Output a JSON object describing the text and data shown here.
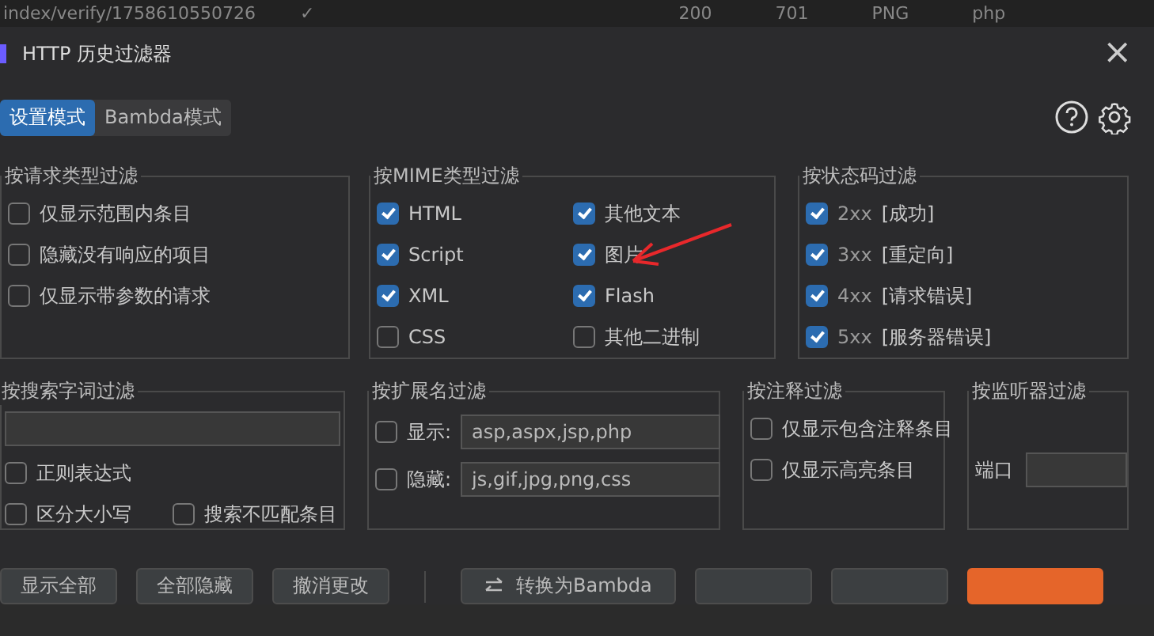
{
  "background_row": [
    "index/verify/1758610550726",
    "✓",
    "200",
    "701",
    "PNG",
    "php"
  ],
  "window": {
    "title": "HTTP 历史过滤器",
    "close": "×"
  },
  "mode_tabs": [
    {
      "label": "设置模式",
      "selected": true
    },
    {
      "label": "Bambda模式",
      "selected": false
    }
  ],
  "request_type": {
    "title": "按请求类型过滤",
    "items": [
      {
        "label": "仅显示范围内条目",
        "checked": false
      },
      {
        "label": "隐藏没有响应的项目",
        "checked": false
      },
      {
        "label": "仅显示带参数的请求",
        "checked": false
      }
    ]
  },
  "mime": {
    "title": "按MIME类型过滤",
    "items": [
      {
        "label": "HTML",
        "checked": true
      },
      {
        "label": "其他文本",
        "checked": true
      },
      {
        "label": "Script",
        "checked": true
      },
      {
        "label": "图片",
        "checked": true
      },
      {
        "label": "XML",
        "checked": true
      },
      {
        "label": "Flash",
        "checked": true
      },
      {
        "label": "CSS",
        "checked": false
      },
      {
        "label": "其他二进制",
        "checked": false
      }
    ]
  },
  "status": {
    "title": "按状态码过滤",
    "items": [
      {
        "code": "2xx",
        "label": "[成功]",
        "checked": true
      },
      {
        "code": "3xx",
        "label": "[重定向]",
        "checked": true
      },
      {
        "code": "4xx",
        "label": "[请求错误]",
        "checked": true
      },
      {
        "code": "5xx",
        "label": "[服务器错误]",
        "checked": true
      }
    ]
  },
  "search": {
    "title": "按搜索字词过滤",
    "regex": {
      "label": "正则表达式",
      "checked": false
    },
    "case": {
      "label": "区分大小写",
      "checked": false
    },
    "negate": {
      "label": "搜索不匹配条目",
      "checked": false
    }
  },
  "extension": {
    "title": "按扩展名过滤",
    "rows": [
      {
        "label": "显示:",
        "checked": false,
        "value": "asp,aspx,jsp,php"
      },
      {
        "label": "隐藏:",
        "checked": false,
        "value": "js,gif,jpg,png,css"
      }
    ]
  },
  "annotation": {
    "title": "按注释过滤",
    "items": [
      {
        "label": "仅显示包含注释条目",
        "checked": false
      },
      {
        "label": "仅显示高亮条目",
        "checked": false
      }
    ]
  },
  "listener": {
    "title": "按监听器过滤",
    "port_label": "端口"
  },
  "buttons": [
    {
      "label": "显示全部",
      "kind": "plain"
    },
    {
      "label": "全部隐藏",
      "kind": "plain"
    },
    {
      "label": "撤消更改",
      "kind": "plain"
    },
    {
      "kind": "separator"
    },
    {
      "label": "转换为Bambda",
      "kind": "convert"
    },
    {
      "kind": "covered"
    },
    {
      "kind": "covered"
    },
    {
      "kind": "covered-primary"
    }
  ]
}
